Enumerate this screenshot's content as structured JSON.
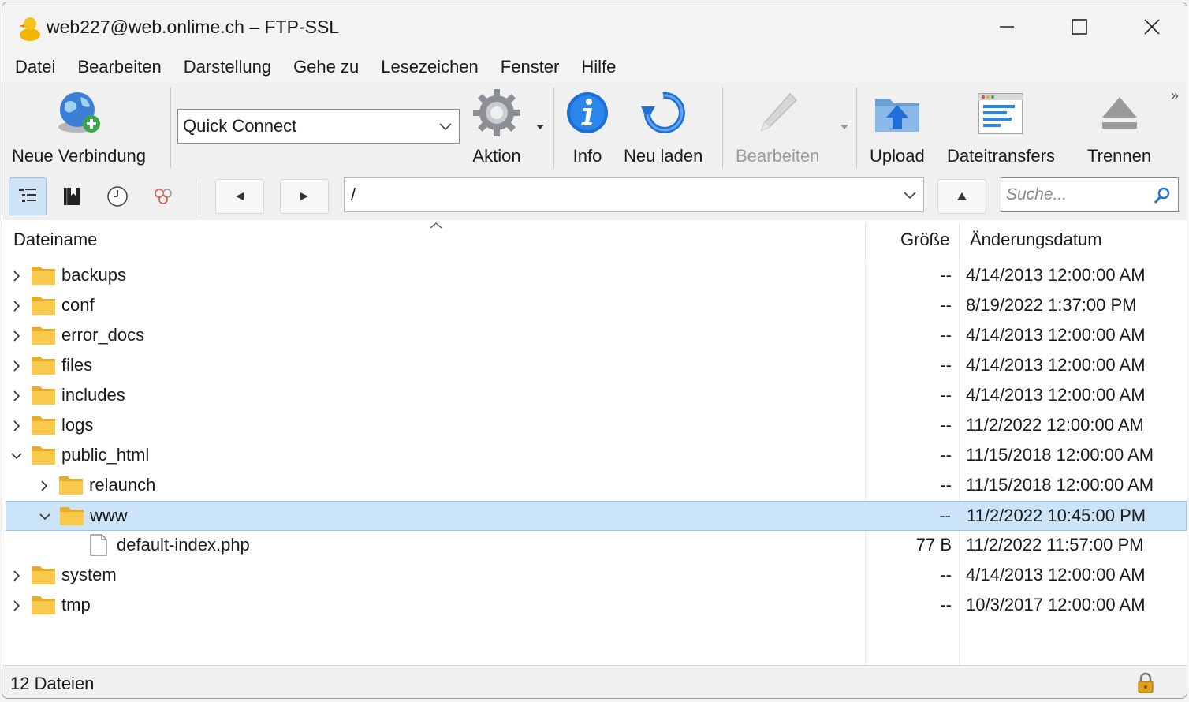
{
  "window": {
    "title": "web227@web.onlime.ch – FTP-SSL"
  },
  "menu": [
    "Datei",
    "Bearbeiten",
    "Darstellung",
    "Gehe zu",
    "Lesezeichen",
    "Fenster",
    "Hilfe"
  ],
  "toolbar": {
    "new_connection": "Neue Verbindung",
    "quick_connect": "Quick Connect",
    "action": "Aktion",
    "info": "Info",
    "reload": "Neu laden",
    "edit": "Bearbeiten",
    "upload": "Upload",
    "transfers": "Dateitransfers",
    "disconnect": "Trennen"
  },
  "navigation": {
    "path": "/",
    "search_placeholder": "Suche..."
  },
  "columns": {
    "name": "Dateiname",
    "size": "Größe",
    "modified": "Änderungsdatum"
  },
  "files": [
    {
      "name": "backups",
      "size": "--",
      "date": "4/14/2013 12:00:00 AM",
      "type": "folder",
      "level": 0,
      "expanded": false,
      "selected": false
    },
    {
      "name": "conf",
      "size": "--",
      "date": "8/19/2022 1:37:00 PM",
      "type": "folder",
      "level": 0,
      "expanded": false,
      "selected": false
    },
    {
      "name": "error_docs",
      "size": "--",
      "date": "4/14/2013 12:00:00 AM",
      "type": "folder",
      "level": 0,
      "expanded": false,
      "selected": false
    },
    {
      "name": "files",
      "size": "--",
      "date": "4/14/2013 12:00:00 AM",
      "type": "folder",
      "level": 0,
      "expanded": false,
      "selected": false
    },
    {
      "name": "includes",
      "size": "--",
      "date": "4/14/2013 12:00:00 AM",
      "type": "folder",
      "level": 0,
      "expanded": false,
      "selected": false
    },
    {
      "name": "logs",
      "size": "--",
      "date": "11/2/2022 12:00:00 AM",
      "type": "folder",
      "level": 0,
      "expanded": false,
      "selected": false
    },
    {
      "name": "public_html",
      "size": "--",
      "date": "11/15/2018 12:00:00 AM",
      "type": "folder",
      "level": 0,
      "expanded": true,
      "selected": false
    },
    {
      "name": "relaunch",
      "size": "--",
      "date": "11/15/2018 12:00:00 AM",
      "type": "folder",
      "level": 1,
      "expanded": false,
      "selected": false
    },
    {
      "name": "www",
      "size": "--",
      "date": "11/2/2022 10:45:00 PM",
      "type": "folder",
      "level": 1,
      "expanded": true,
      "selected": true
    },
    {
      "name": "default-index.php",
      "size": "77 B",
      "date": "11/2/2022 11:57:00 PM",
      "type": "file",
      "level": 2,
      "expanded": false,
      "selected": false
    },
    {
      "name": "system",
      "size": "--",
      "date": "4/14/2013 12:00:00 AM",
      "type": "folder",
      "level": 0,
      "expanded": false,
      "selected": false
    },
    {
      "name": "tmp",
      "size": "--",
      "date": "10/3/2017 12:00:00 AM",
      "type": "folder",
      "level": 0,
      "expanded": false,
      "selected": false
    }
  ],
  "status": {
    "text": "12 Dateien"
  },
  "colors": {
    "folder": "#f8c94a",
    "selection": "#cce4f7",
    "accent": "#1f78d1"
  }
}
